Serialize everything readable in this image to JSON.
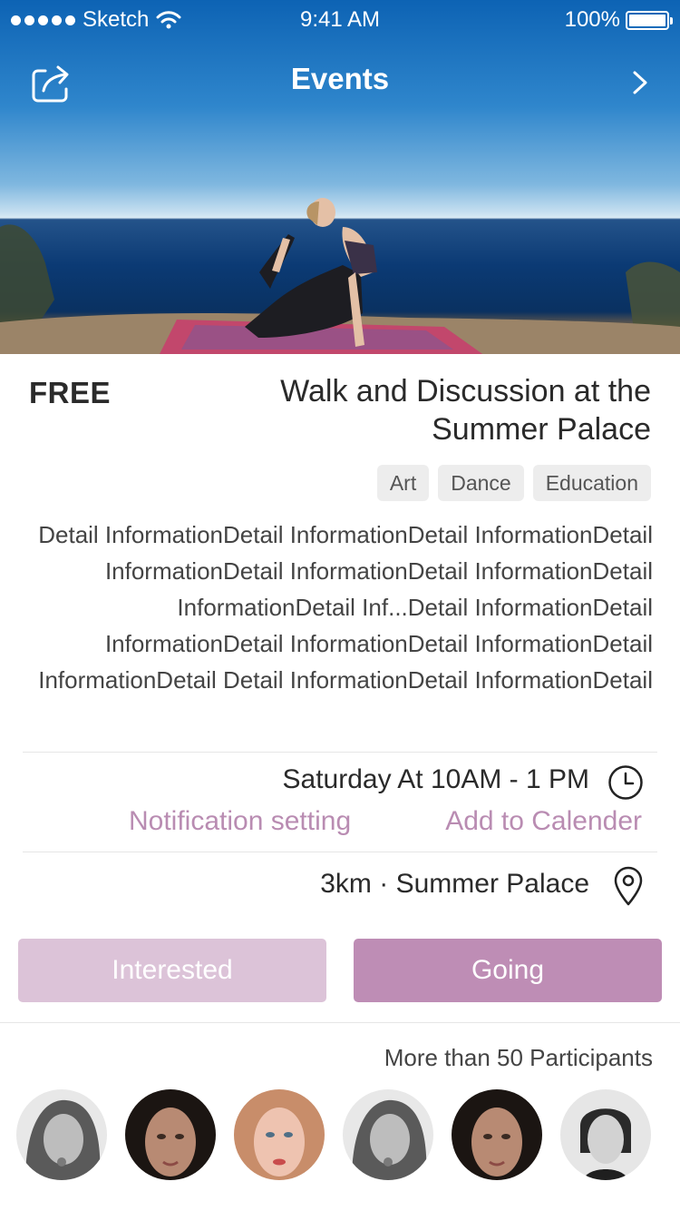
{
  "status_bar": {
    "carrier": "Sketch",
    "time": "9:41 AM",
    "battery": "100%",
    "battery_level": 1.0
  },
  "navbar": {
    "title": "Events",
    "share_icon": "share-icon",
    "next_icon": "chevron-right-icon"
  },
  "event": {
    "price": "FREE",
    "title": "Walk and Discussion at the Summer Palace",
    "tags": [
      "Art",
      "Dance",
      "Education"
    ],
    "detail": "Detail InformationDetail InformationDetail InformationDetail InformationDetail InformationDetail InformationDetail InformationDetail Inf...Detail InformationDetail InformationDetail InformationDetail InformationDetail InformationDetail Detail InformationDetail InformationDetail",
    "time": "Saturday At 10AM - 1 PM",
    "notification_link": "Notification setting",
    "calendar_link": "Add to Calender",
    "location": "3km · Summer Palace"
  },
  "actions": {
    "interested": "Interested",
    "going": "Going"
  },
  "participants": {
    "summary": "More than 50 Participants",
    "avatars": [
      "avatar-1",
      "avatar-2",
      "avatar-3",
      "avatar-4",
      "avatar-5",
      "avatar-6"
    ]
  },
  "colors": {
    "accent": "#be8db5",
    "accent_light": "#dcc3d8",
    "link": "#b98cb2",
    "tag_bg": "#ededed"
  }
}
